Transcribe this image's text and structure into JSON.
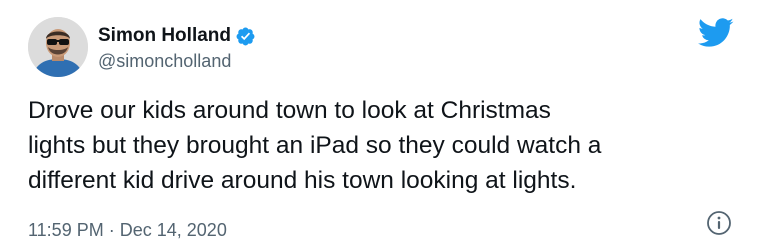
{
  "author": {
    "display_name": "Simon Holland",
    "handle": "@simoncholland",
    "verified": true,
    "avatar_icon": "profile-photo-man-sunglasses"
  },
  "tweet": {
    "text": "Drove our kids around town to look at Christmas\nlights but they brought an iPad so they could watch a\ndifferent kid drive around his town looking at lights.",
    "time": "11:59 PM",
    "separator": "·",
    "date": "Dec 14, 2020"
  },
  "icons": {
    "brand": "twitter-bird-icon",
    "verified": "verified-badge-icon",
    "info": "info-icon"
  },
  "colors": {
    "twitter_blue": "#1d9bf0",
    "secondary_text": "#536471",
    "primary_text": "#0f1419"
  }
}
